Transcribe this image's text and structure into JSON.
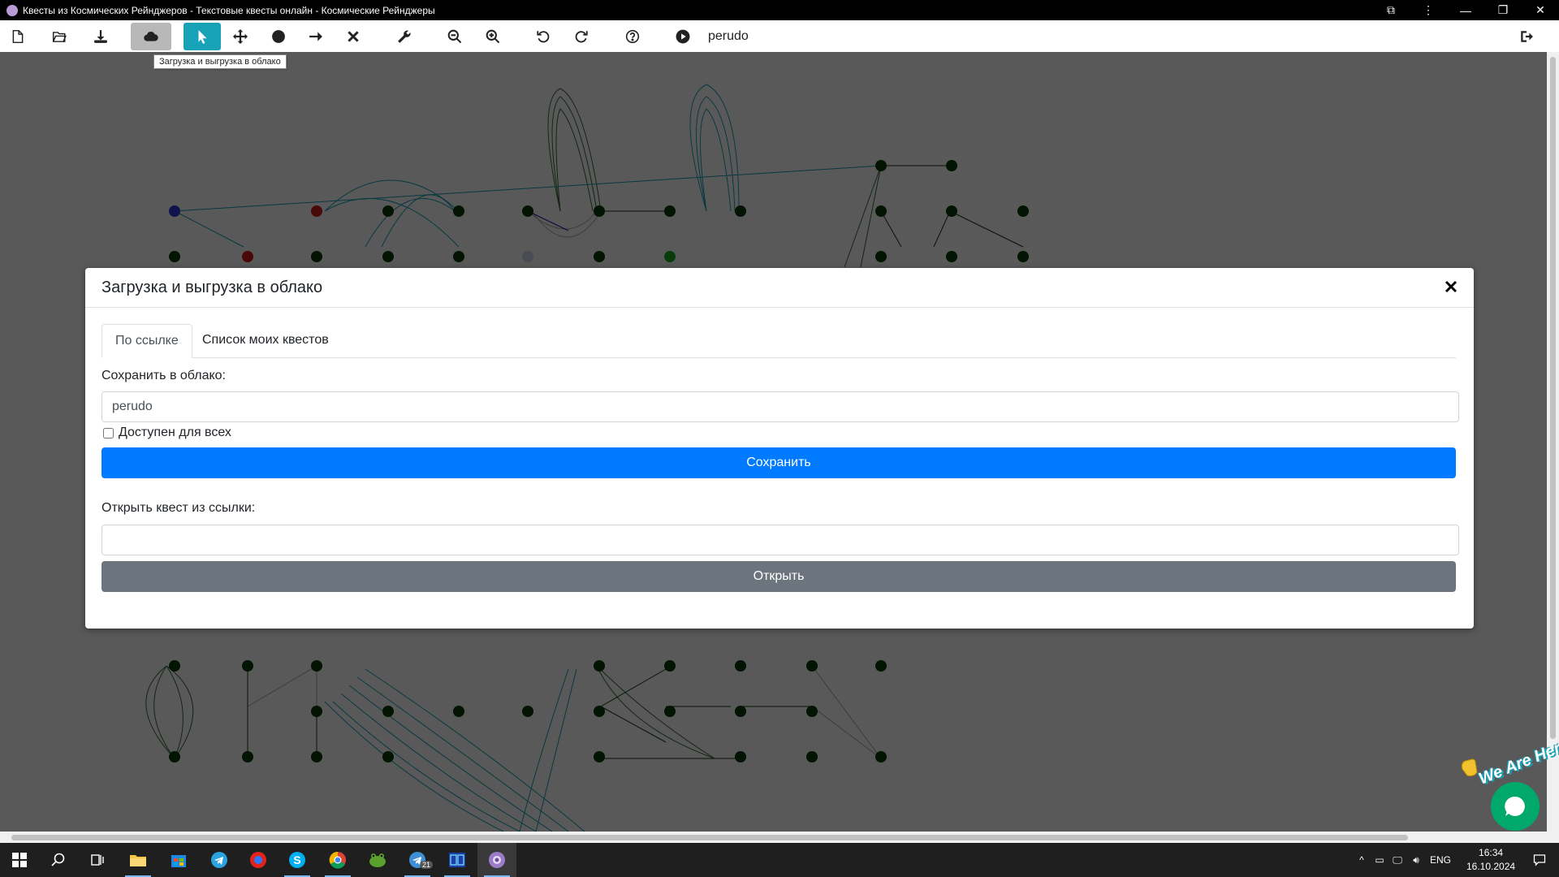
{
  "window": {
    "title": "Квесты из Космических Рейнджеров - Текстовые квесты онлайн - Космические Рейнджеры"
  },
  "toolbar": {
    "quest_name": "perudo",
    "tooltip": "Загрузка и выгрузка в облако",
    "buttons": [
      "new-file-icon",
      "open-folder-icon",
      "download-icon",
      "cloud-icon",
      "select-cursor-icon",
      "move-icon",
      "add-location-icon",
      "add-jump-icon",
      "delete-icon",
      "wrench-icon",
      "zoom-out-icon",
      "zoom-in-icon",
      "undo-icon",
      "redo-icon",
      "help-icon",
      "play-icon",
      "exit-icon"
    ]
  },
  "modal": {
    "title": "Загрузка и выгрузка в облако",
    "tabs": [
      {
        "label": "По ссылке",
        "active": true
      },
      {
        "label": "Список моих квестов",
        "active": false
      }
    ],
    "save_label": "Сохранить в облако:",
    "save_value": "perudo",
    "public_checkbox_label": "Доступен для всех",
    "public_checked": false,
    "save_button": "Сохранить",
    "open_label": "Открыть квест из ссылки:",
    "open_value": "",
    "open_button": "Открыть"
  },
  "chat_widget": {
    "label": "We Are Here!"
  },
  "taskbar": {
    "apps": [
      "start-icon",
      "search-icon",
      "task-view-icon",
      "file-explorer-icon",
      "store-icon",
      "telegram-icon",
      "yandex-icon",
      "skype-icon",
      "chrome-icon",
      "frog-app-icon",
      "telegram-desktop-icon",
      "far-manager-icon",
      "space-rangers-icon"
    ],
    "telegram_badge": "21",
    "language": "ENG",
    "time": "16:34",
    "date": "16.10.2024"
  },
  "colors": {
    "primary": "#007bff",
    "secondary": "#6c757d",
    "active_tool": "#17a2b8",
    "chat": "#00a86b"
  }
}
